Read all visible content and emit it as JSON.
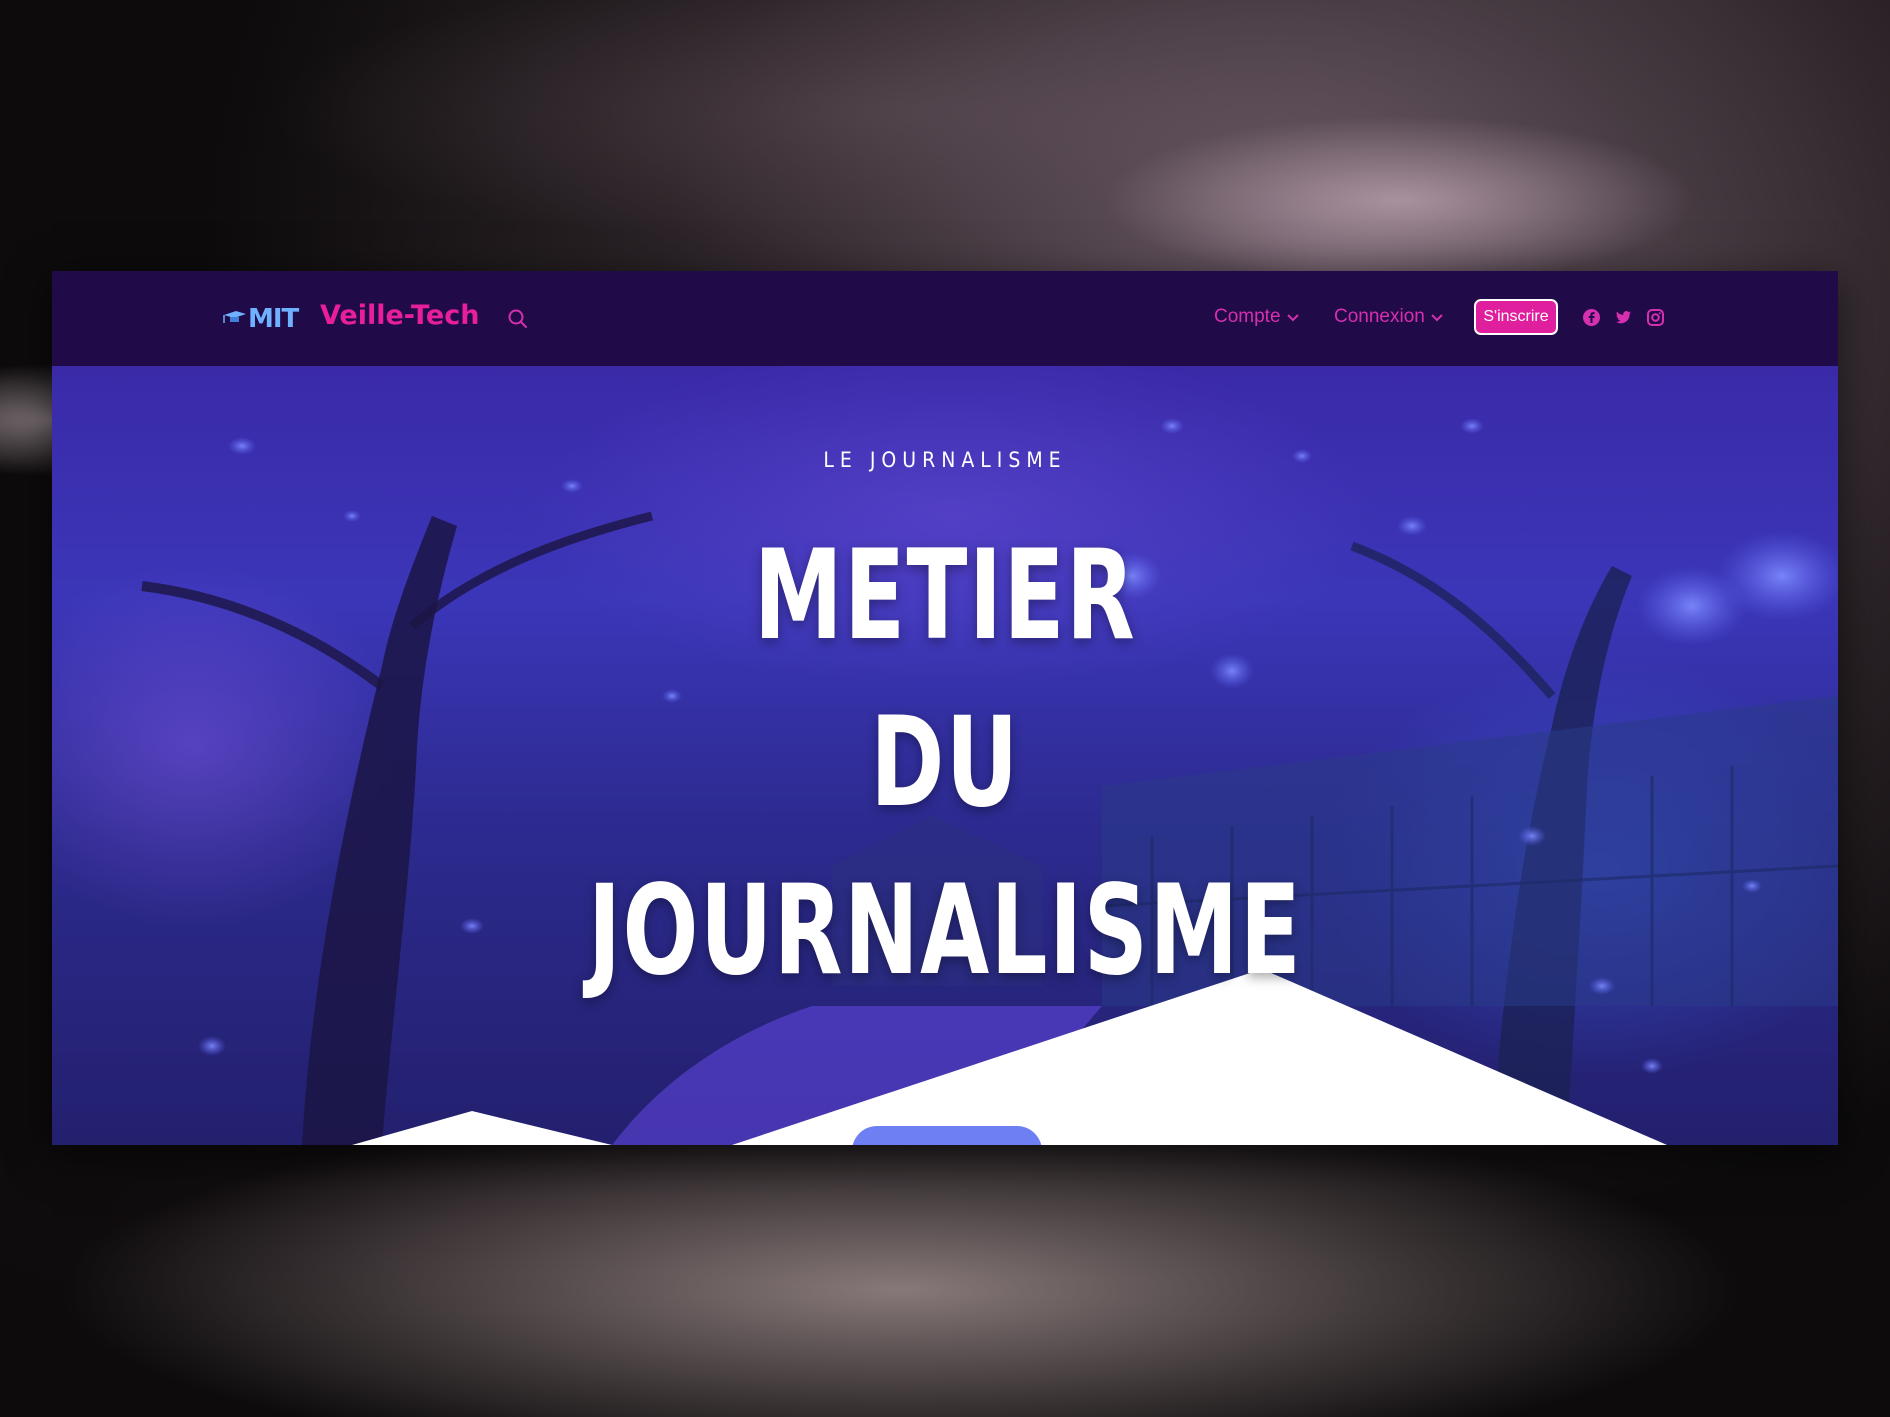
{
  "header": {
    "logo_text": "MIT",
    "brand": "Veille-Tech",
    "nav": [
      {
        "label": "Compte"
      },
      {
        "label": "Connexion"
      }
    ],
    "signup_label": "S'inscrire"
  },
  "hero": {
    "eyebrow": "LE JOURNALISME",
    "title_lines": [
      "METIER",
      "DU",
      "JOURNALISME"
    ]
  },
  "colors": {
    "navbar_bg": "#210a48",
    "accent_pink": "#e81e9c",
    "logo_blue": "#6fb1ff",
    "cta_blue": "#6d7ff2"
  }
}
